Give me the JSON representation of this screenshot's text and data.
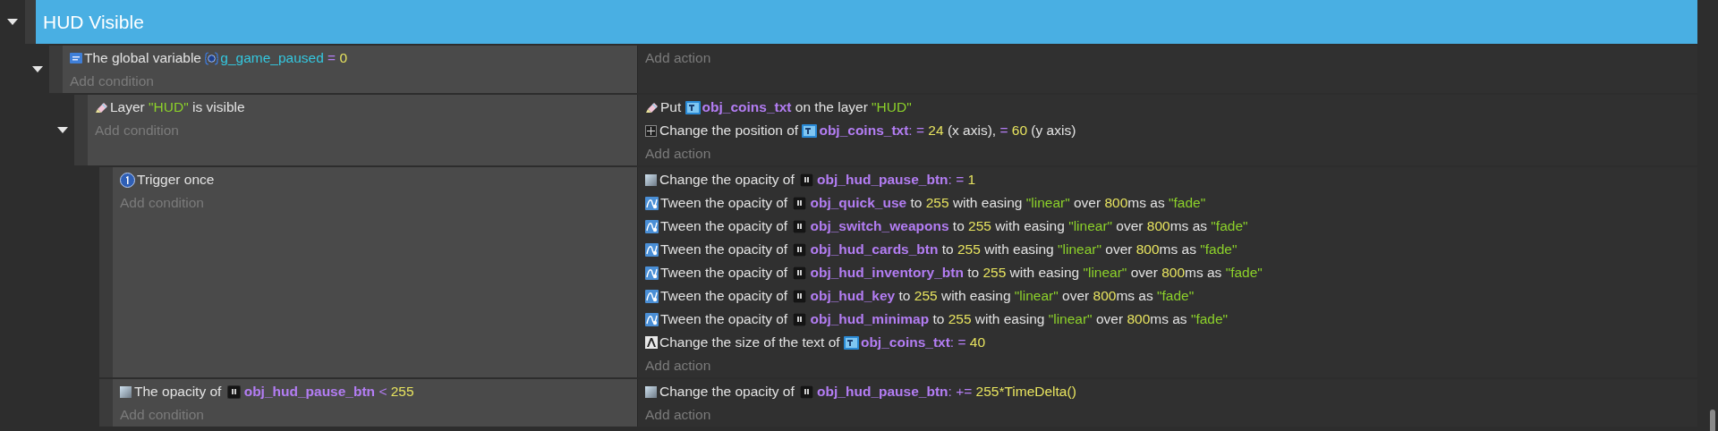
{
  "group": {
    "title": "HUD Visible",
    "expanded": true,
    "events": [
      {
        "expanded": true,
        "conditions": [
          {
            "kind": "variable",
            "parts": [
              {
                "kind": "plain",
                "text": "The global variable "
              },
              {
                "kind": "variable",
                "text": "g_game_paused"
              },
              {
                "kind": "operator",
                "text": " = "
              },
              {
                "kind": "number",
                "text": "0"
              }
            ]
          }
        ],
        "add_condition": "Add condition",
        "add_action": "Add action",
        "children": [
          {
            "expanded": true,
            "conditions": [
              {
                "kind": "layer",
                "parts": [
                  {
                    "kind": "plain",
                    "text": "Layer "
                  },
                  {
                    "kind": "string",
                    "text": "\"HUD\""
                  },
                  {
                    "kind": "plain",
                    "text": " is visible"
                  }
                ]
              }
            ],
            "add_condition": "Add condition",
            "actions": [
              {
                "kind": "layer",
                "parts": [
                  {
                    "kind": "plain",
                    "text": "Put "
                  },
                  {
                    "kind": "text_object",
                    "text": "obj_coins_txt"
                  },
                  {
                    "kind": "plain",
                    "text": " on the layer "
                  },
                  {
                    "kind": "string",
                    "text": "\"HUD\""
                  }
                ]
              },
              {
                "kind": "position",
                "parts": [
                  {
                    "kind": "plain",
                    "text": "Change the position of "
                  },
                  {
                    "kind": "text_object",
                    "text": "obj_coins_txt"
                  },
                  {
                    "kind": "operator",
                    "text": ": = "
                  },
                  {
                    "kind": "number",
                    "text": "24"
                  },
                  {
                    "kind": "plain",
                    "text": " (x axis), "
                  },
                  {
                    "kind": "operator",
                    "text": "= "
                  },
                  {
                    "kind": "number",
                    "text": "60"
                  },
                  {
                    "kind": "plain",
                    "text": " (y axis)"
                  }
                ]
              }
            ],
            "add_action": "Add action",
            "children": [
              {
                "conditions": [
                  {
                    "kind": "trigger",
                    "parts": [
                      {
                        "kind": "plain",
                        "text": "Trigger once"
                      }
                    ]
                  }
                ],
                "add_condition": "Add condition",
                "actions": [
                  {
                    "kind": "opacity",
                    "parts": [
                      {
                        "kind": "plain",
                        "text": "Change the opacity of "
                      },
                      {
                        "kind": "sprite_object",
                        "text": "obj_hud_pause_btn"
                      },
                      {
                        "kind": "operator",
                        "text": ": = "
                      },
                      {
                        "kind": "number",
                        "text": "1"
                      }
                    ]
                  },
                  {
                    "kind": "tween",
                    "parts": [
                      {
                        "kind": "plain",
                        "text": "Tween the opacity of "
                      },
                      {
                        "kind": "sprite_object",
                        "text": "obj_quick_use"
                      },
                      {
                        "kind": "plain",
                        "text": " to "
                      },
                      {
                        "kind": "number",
                        "text": "255"
                      },
                      {
                        "kind": "plain",
                        "text": " with easing "
                      },
                      {
                        "kind": "string",
                        "text": "\"linear\""
                      },
                      {
                        "kind": "plain",
                        "text": " over "
                      },
                      {
                        "kind": "number",
                        "text": "800"
                      },
                      {
                        "kind": "plain",
                        "text": "ms as "
                      },
                      {
                        "kind": "string",
                        "text": "\"fade\""
                      }
                    ]
                  },
                  {
                    "kind": "tween",
                    "parts": [
                      {
                        "kind": "plain",
                        "text": "Tween the opacity of "
                      },
                      {
                        "kind": "sprite_object",
                        "text": "obj_switch_weapons"
                      },
                      {
                        "kind": "plain",
                        "text": " to "
                      },
                      {
                        "kind": "number",
                        "text": "255"
                      },
                      {
                        "kind": "plain",
                        "text": " with easing "
                      },
                      {
                        "kind": "string",
                        "text": "\"linear\""
                      },
                      {
                        "kind": "plain",
                        "text": " over "
                      },
                      {
                        "kind": "number",
                        "text": "800"
                      },
                      {
                        "kind": "plain",
                        "text": "ms as "
                      },
                      {
                        "kind": "string",
                        "text": "\"fade\""
                      }
                    ]
                  },
                  {
                    "kind": "tween",
                    "parts": [
                      {
                        "kind": "plain",
                        "text": "Tween the opacity of "
                      },
                      {
                        "kind": "sprite_object",
                        "text": "obj_hud_cards_btn"
                      },
                      {
                        "kind": "plain",
                        "text": " to "
                      },
                      {
                        "kind": "number",
                        "text": "255"
                      },
                      {
                        "kind": "plain",
                        "text": " with easing "
                      },
                      {
                        "kind": "string",
                        "text": "\"linear\""
                      },
                      {
                        "kind": "plain",
                        "text": " over "
                      },
                      {
                        "kind": "number",
                        "text": "800"
                      },
                      {
                        "kind": "plain",
                        "text": "ms as "
                      },
                      {
                        "kind": "string",
                        "text": "\"fade\""
                      }
                    ]
                  },
                  {
                    "kind": "tween",
                    "parts": [
                      {
                        "kind": "plain",
                        "text": "Tween the opacity of "
                      },
                      {
                        "kind": "sprite_object",
                        "text": "obj_hud_inventory_btn"
                      },
                      {
                        "kind": "plain",
                        "text": " to "
                      },
                      {
                        "kind": "number",
                        "text": "255"
                      },
                      {
                        "kind": "plain",
                        "text": " with easing "
                      },
                      {
                        "kind": "string",
                        "text": "\"linear\""
                      },
                      {
                        "kind": "plain",
                        "text": " over "
                      },
                      {
                        "kind": "number",
                        "text": "800"
                      },
                      {
                        "kind": "plain",
                        "text": "ms as "
                      },
                      {
                        "kind": "string",
                        "text": "\"fade\""
                      }
                    ]
                  },
                  {
                    "kind": "tween",
                    "parts": [
                      {
                        "kind": "plain",
                        "text": "Tween the opacity of "
                      },
                      {
                        "kind": "sprite_object",
                        "text": "obj_hud_key"
                      },
                      {
                        "kind": "plain",
                        "text": " to "
                      },
                      {
                        "kind": "number",
                        "text": "255"
                      },
                      {
                        "kind": "plain",
                        "text": " with easing "
                      },
                      {
                        "kind": "string",
                        "text": "\"linear\""
                      },
                      {
                        "kind": "plain",
                        "text": " over "
                      },
                      {
                        "kind": "number",
                        "text": "800"
                      },
                      {
                        "kind": "plain",
                        "text": "ms as "
                      },
                      {
                        "kind": "string",
                        "text": "\"fade\""
                      }
                    ]
                  },
                  {
                    "kind": "tween",
                    "parts": [
                      {
                        "kind": "plain",
                        "text": "Tween the opacity of "
                      },
                      {
                        "kind": "sprite_object",
                        "text": "obj_hud_minimap"
                      },
                      {
                        "kind": "plain",
                        "text": " to "
                      },
                      {
                        "kind": "number",
                        "text": "255"
                      },
                      {
                        "kind": "plain",
                        "text": " with easing "
                      },
                      {
                        "kind": "string",
                        "text": "\"linear\""
                      },
                      {
                        "kind": "plain",
                        "text": " over "
                      },
                      {
                        "kind": "number",
                        "text": "800"
                      },
                      {
                        "kind": "plain",
                        "text": "ms as "
                      },
                      {
                        "kind": "string",
                        "text": "\"fade\""
                      }
                    ]
                  },
                  {
                    "kind": "text_size",
                    "parts": [
                      {
                        "kind": "plain",
                        "text": "Change the size of the text of "
                      },
                      {
                        "kind": "text_object",
                        "text": "obj_coins_txt"
                      },
                      {
                        "kind": "operator",
                        "text": ": = "
                      },
                      {
                        "kind": "number",
                        "text": "40"
                      }
                    ]
                  }
                ],
                "add_action": "Add action"
              },
              {
                "conditions": [
                  {
                    "kind": "opacity",
                    "parts": [
                      {
                        "kind": "plain",
                        "text": "The opacity of "
                      },
                      {
                        "kind": "sprite_object",
                        "text": "obj_hud_pause_btn"
                      },
                      {
                        "kind": "operator",
                        "text": " < "
                      },
                      {
                        "kind": "number",
                        "text": "255"
                      }
                    ]
                  }
                ],
                "add_condition": "Add condition",
                "actions": [
                  {
                    "kind": "opacity",
                    "parts": [
                      {
                        "kind": "plain",
                        "text": "Change the opacity of "
                      },
                      {
                        "kind": "sprite_object",
                        "text": "obj_hud_pause_btn"
                      },
                      {
                        "kind": "operator",
                        "text": ": += "
                      },
                      {
                        "kind": "number",
                        "text": "255*TimeDelta()"
                      }
                    ]
                  }
                ],
                "add_action": "Add action"
              }
            ]
          }
        ]
      }
    ]
  }
}
